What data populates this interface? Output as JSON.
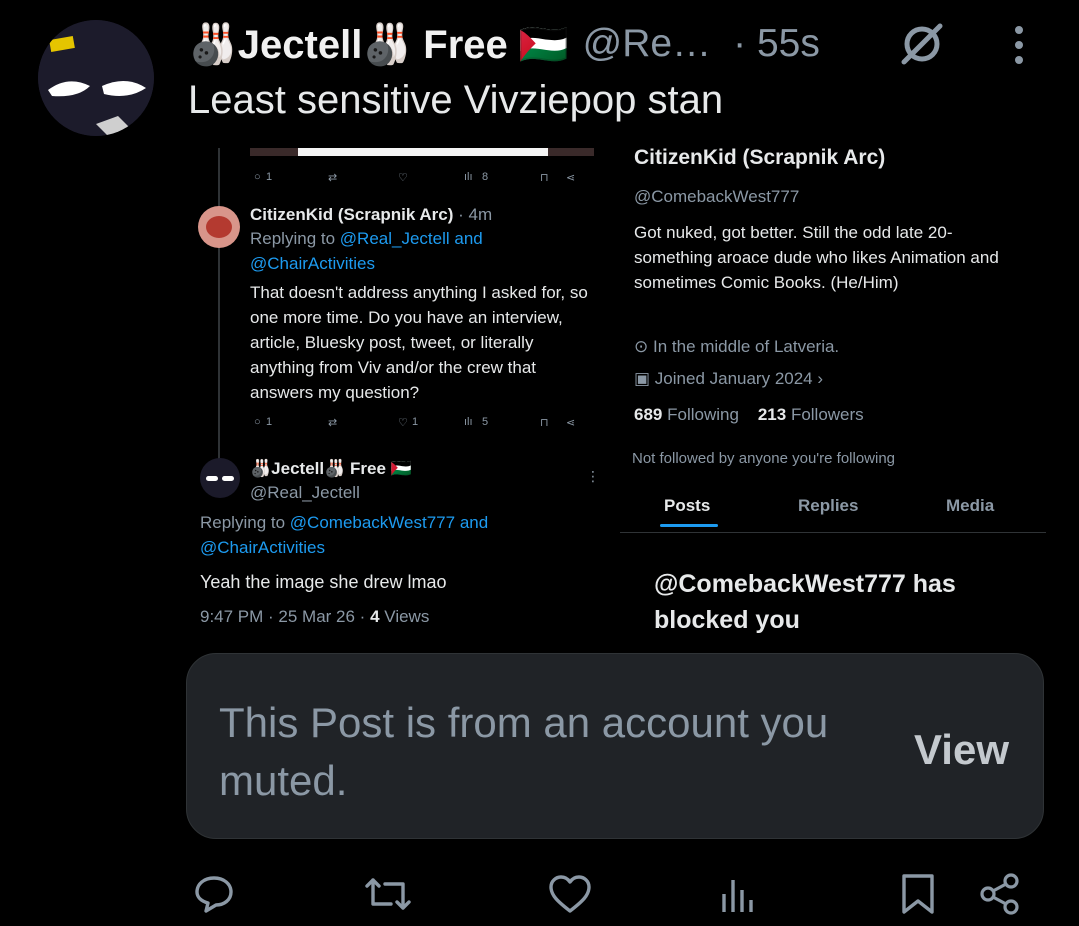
{
  "post": {
    "author_name": "🎳Jectell🎳 Free 🇵🇸",
    "handle": "@Re…",
    "time": "· 55s",
    "text": "Least sensitive Vivziepop stan",
    "muted_notice": "This Post is from an account you muted.",
    "view_label": "View"
  },
  "left_shot": {
    "top_actions": {
      "replies": "1",
      "reposts": "",
      "likes": "",
      "views": "8"
    },
    "reply": {
      "author": "CitizenKid (Scrapnik Arc)",
      "time": "· 4m",
      "replying_prefix": "Replying to",
      "replying_to_1": "@Real_Jectell and",
      "replying_to_2": "@ChairActivities",
      "text": "That doesn't address anything I asked for, so one more time. Do you have an interview, article, Bluesky post, tweet, or literally anything from Viv and/or the crew that answers my question?",
      "actions": {
        "replies": "1",
        "reposts": "",
        "likes": "1",
        "views": "5"
      }
    },
    "main": {
      "author": "🎳Jectell🎳 Free 🇵🇸",
      "handle": "@Real_Jectell",
      "replying_prefix": "Replying to",
      "replying_to_1": "@ComebackWest777 and",
      "replying_to_2": "@ChairActivities",
      "text": "Yeah the image she drew lmao",
      "meta_time": "9:47 PM · 25 Mar 26 ·",
      "meta_views": "4",
      "meta_views_label": "Views"
    }
  },
  "right_shot": {
    "name": "CitizenKid (Scrapnik Arc)",
    "handle": "@ComebackWest777",
    "bio": "Got nuked, got better.  Still the odd late 20-something aroace dude who likes Animation and sometimes Comic Books. (He/Him)",
    "location": "In the middle of Latveria.",
    "joined": "Joined January 2024",
    "following_count": "689",
    "following_label": "Following",
    "followers_count": "213",
    "followers_label": "Followers",
    "not_followed": "Not followed by anyone you're following",
    "tabs": [
      "Posts",
      "Replies",
      "Media"
    ],
    "blocked": "@ComebackWest777 has blocked you"
  },
  "colors": {
    "background": "#000000",
    "muted_box": "#202327",
    "link": "#1d9bf0",
    "secondary": "#8b98a5"
  }
}
